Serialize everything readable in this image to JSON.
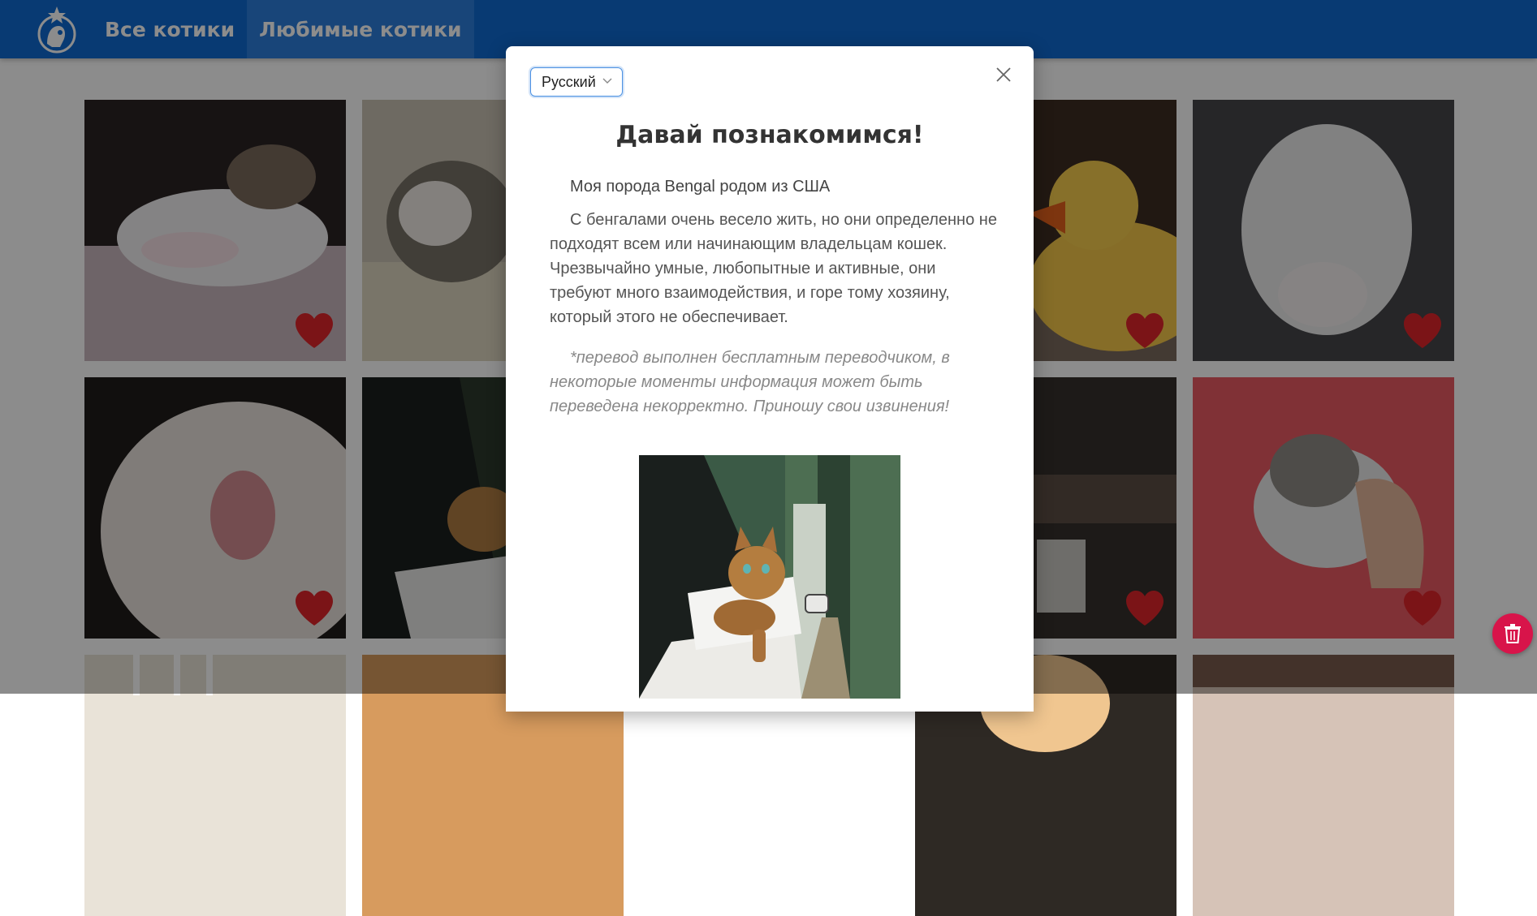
{
  "header": {
    "logo_icon": "cat-paw-star-logo-icon",
    "nav": [
      {
        "label": "Все котики",
        "active": false
      },
      {
        "label": "Любимые котики",
        "active": true
      }
    ]
  },
  "grid": {
    "favorite_icon": "heart-icon",
    "favorite_color": "#e0252b"
  },
  "modal": {
    "language": {
      "selected": "Русский"
    },
    "title": "Давай познакомимся!",
    "breed_line": "Моя порода Bengal родом из США",
    "description": "С бенгалами очень весело жить, но они определенно не подходят всем или начинающим владельцам кошек. Чрезвычайно умные, любопытные и активные, они требуют много взаимодействия, и горе тому хозяину, который этого не обеспечивает.",
    "translation_note": "*перевод выполнен бесплатным переводчиком, в некоторые моменты информация может быть переведена некорректно. Приношу свои извинения!"
  },
  "trash_button": {
    "icon": "trash-icon",
    "color": "#d8144a"
  }
}
